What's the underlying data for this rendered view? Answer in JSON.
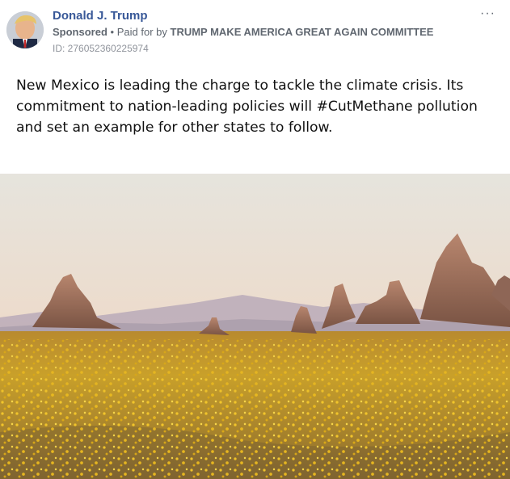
{
  "advertiser": {
    "name": "Donald J. Trump",
    "sponsored_label": "Sponsored",
    "separator": "•",
    "paid_for_prefix": "Paid for by",
    "committee": "TRUMP MAKE AMERICA GREAT AGAIN COMMITTEE",
    "ad_id": "ID: 276052360225974"
  },
  "post": {
    "text": "New Mexico is leading the charge to tackle the climate crisis. Its commitment to nation-leading policies will #CutMethane pollution and set an example for other states to follow."
  },
  "menu": {
    "more_icon": "ellipsis-icon",
    "more_label": "···"
  },
  "colors": {
    "link_blue": "#385898",
    "meta_gray": "#606770",
    "id_gray": "#90949c"
  }
}
